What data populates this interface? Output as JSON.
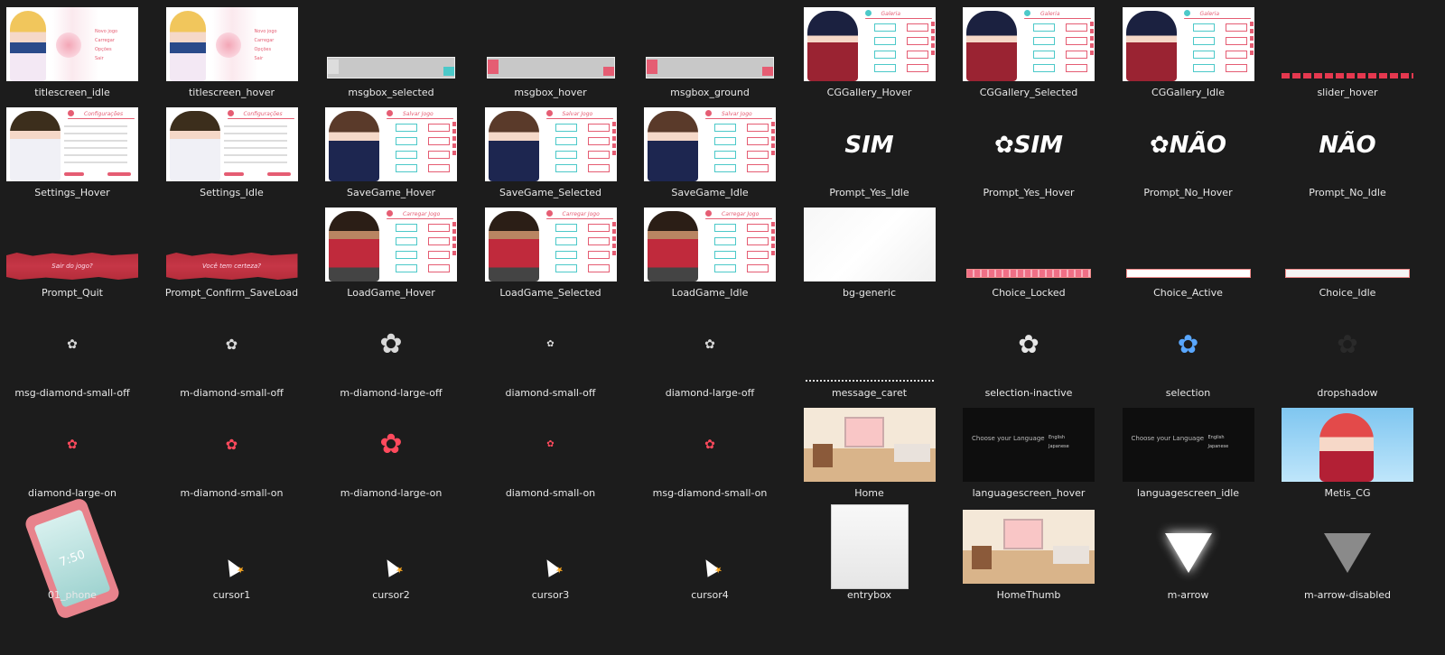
{
  "window": {
    "title": ""
  },
  "files": [
    {
      "name": "titlescreen_idle",
      "kind": "titlescreen"
    },
    {
      "name": "titlescreen_hover",
      "kind": "titlescreen"
    },
    {
      "name": "msgbox_selected",
      "kind": "msgbox"
    },
    {
      "name": "msgbox_hover",
      "kind": "msgbox"
    },
    {
      "name": "msgbox_ground",
      "kind": "msgbox"
    },
    {
      "name": "CGGallery_Hover",
      "kind": "gallery"
    },
    {
      "name": "CGGallery_Selected",
      "kind": "gallery"
    },
    {
      "name": "CGGallery_Idle",
      "kind": "gallery"
    },
    {
      "name": "slider_hover",
      "kind": "slider"
    },
    {
      "name": "Settings_Hover",
      "kind": "settings"
    },
    {
      "name": "Settings_Idle",
      "kind": "settings"
    },
    {
      "name": "SaveGame_Hover",
      "kind": "save"
    },
    {
      "name": "SaveGame_Selected",
      "kind": "save"
    },
    {
      "name": "SaveGame_Idle",
      "kind": "save"
    },
    {
      "name": "Prompt_Yes_Idle",
      "kind": "text",
      "text": "SIM"
    },
    {
      "name": "Prompt_Yes_Hover",
      "kind": "text",
      "text": "✿SIM"
    },
    {
      "name": "Prompt_No_Hover",
      "kind": "text",
      "text": "✿NÃO"
    },
    {
      "name": "Prompt_No_Idle",
      "kind": "text",
      "text": "NÃO"
    },
    {
      "name": "Prompt_Quit",
      "kind": "banner",
      "text": "Sair do jogo?"
    },
    {
      "name": "Prompt_Confirm_SaveLoad",
      "kind": "banner",
      "text": "Você tem certeza?"
    },
    {
      "name": "LoadGame_Hover",
      "kind": "load"
    },
    {
      "name": "LoadGame_Selected",
      "kind": "load"
    },
    {
      "name": "LoadGame_Idle",
      "kind": "load"
    },
    {
      "name": "bg-generic",
      "kind": "bg"
    },
    {
      "name": "Choice_Locked",
      "kind": "choice",
      "color": "#f06f86"
    },
    {
      "name": "Choice_Active",
      "kind": "choice",
      "color": "#ffffff"
    },
    {
      "name": "Choice_Idle",
      "kind": "choice",
      "color": "#f4f4f4"
    },
    {
      "name": "msg-diamond-small-off",
      "kind": "flower",
      "size": 14,
      "color": "#d8d8d8"
    },
    {
      "name": "m-diamond-small-off",
      "kind": "flower",
      "size": 16,
      "color": "#d8d8d8"
    },
    {
      "name": "m-diamond-large-off",
      "kind": "flower",
      "size": 30,
      "color": "#d8d8d8"
    },
    {
      "name": "diamond-small-off",
      "kind": "flower",
      "size": 10,
      "color": "#d8d8d8"
    },
    {
      "name": "diamond-large-off",
      "kind": "flower",
      "size": 14,
      "color": "#d8d8d8"
    },
    {
      "name": "message_caret",
      "kind": "caret"
    },
    {
      "name": "selection-inactive",
      "kind": "flower",
      "size": 28,
      "color": "#e6e6e6"
    },
    {
      "name": "selection",
      "kind": "flower",
      "size": 28,
      "color": "#59a7ff"
    },
    {
      "name": "dropshadow",
      "kind": "flower",
      "size": 28,
      "color": "#2a2a2a"
    },
    {
      "name": "diamond-large-on",
      "kind": "flower",
      "size": 14,
      "color": "#ff4a5d"
    },
    {
      "name": "m-diamond-small-on",
      "kind": "flower",
      "size": 16,
      "color": "#ff4a5d"
    },
    {
      "name": "m-diamond-large-on",
      "kind": "flower",
      "size": 30,
      "color": "#ff4a5d"
    },
    {
      "name": "diamond-small-on",
      "kind": "flower",
      "size": 10,
      "color": "#ff4a5d"
    },
    {
      "name": "msg-diamond-small-on",
      "kind": "flower",
      "size": 14,
      "color": "#ff4a5d"
    },
    {
      "name": "Home",
      "kind": "room"
    },
    {
      "name": "languagescreen_hover",
      "kind": "language",
      "title": "Choose your Language",
      "opt1": "English",
      "opt2": "Japanese"
    },
    {
      "name": "languagescreen_idle",
      "kind": "language",
      "title": "Choose your Language",
      "opt1": "English",
      "opt2": "Japanese"
    },
    {
      "name": "Metis_CG",
      "kind": "cg"
    },
    {
      "name": "01_phone",
      "kind": "phone",
      "clock": "7:50"
    },
    {
      "name": "cursor1",
      "kind": "cursor"
    },
    {
      "name": "cursor2",
      "kind": "cursor"
    },
    {
      "name": "cursor3",
      "kind": "cursor"
    },
    {
      "name": "cursor4",
      "kind": "cursor"
    },
    {
      "name": "entrybox",
      "kind": "entry"
    },
    {
      "name": "HomeThumb",
      "kind": "room"
    },
    {
      "name": "m-arrow",
      "kind": "arrow",
      "color": "#ffffff"
    },
    {
      "name": "m-arrow-disabled",
      "kind": "arrow",
      "color": "#8a8a8a"
    }
  ],
  "titlescreen_menu": [
    "Novo jogo",
    "Carregar",
    "Opções",
    "Sair"
  ],
  "titles": {
    "gallery": "Galeria",
    "settings": "Configurações",
    "save": "Salvar Jogo",
    "load": "Carregar Jogo"
  }
}
